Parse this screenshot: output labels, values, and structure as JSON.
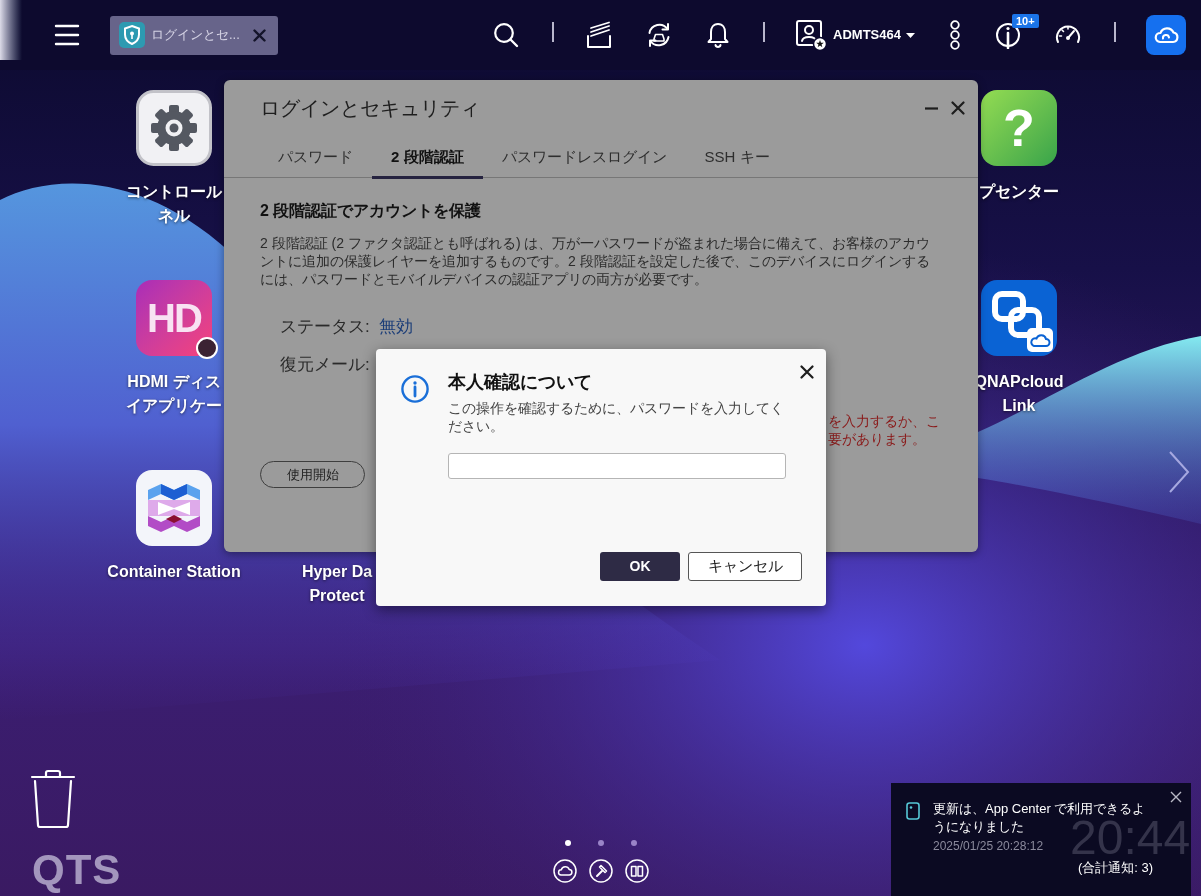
{
  "top_bar": {
    "open_windows": [
      {
        "title": "ログインとセ...",
        "selected": true
      }
    ],
    "user": "ADMTS464",
    "info_badge": "10+"
  },
  "desktop": {
    "left_column": [
      {
        "kind": "gear",
        "label_lines": [
          "コントロール",
          "ネル"
        ]
      },
      {
        "kind": "hd",
        "logo_text": "HD",
        "label_lines": [
          "HDMI ディス",
          "イアプリケー"
        ]
      },
      {
        "kind": "container",
        "label_lines": [
          "Container Station"
        ]
      }
    ],
    "second_column": [
      {
        "label_lines": [
          "Hyper Da",
          "Protect"
        ]
      }
    ],
    "right_column": [
      {
        "kind": "help",
        "logo_text": "?",
        "label_lines": [
          "プセンター"
        ]
      },
      {
        "kind": "cloud_link",
        "label_lines": [
          "QNAPcloud",
          "Link"
        ]
      }
    ]
  },
  "login_window": {
    "title": "ログインとセキュリティ",
    "tabs": [
      {
        "label": "パスワード",
        "selected": false
      },
      {
        "label": "2 段階認証",
        "selected": true
      },
      {
        "label": "パスワードレスログイン",
        "selected": false
      },
      {
        "label": "SSH キー",
        "selected": false
      }
    ],
    "heading": "2 段階認証でアカウントを保護",
    "description": "2 段階認証 (2 ファクタ認証とも呼ばれる) は、万が一パスワードが盗まれた場合に備えて、お客様のアカウントに追加の保護レイヤーを追加するものです。2 段階認証を設定した後で、このデバイスにログインするには、パスワードとモバイルデバイスの認証アプリの両方が必要です。",
    "status": {
      "label": "ステータス:",
      "value": "無効"
    },
    "recovery_email": {
      "label": "復元メール:"
    },
    "warning_lines": [
      "を入力するか、こ",
      "要があります。"
    ],
    "start_button": "使用開始"
  },
  "confirm_dialog": {
    "title": "本人確認について",
    "message": "この操作を確認するために、パスワードを入力してください。",
    "buttons": [
      {
        "label": "OK",
        "kind": "primary"
      },
      {
        "label": "キャンセル",
        "kind": "secondary"
      }
    ]
  },
  "footer": {
    "logo": "QTS",
    "page_dots": [
      {
        "selected": true
      },
      {
        "selected": false
      },
      {
        "selected": false
      }
    ]
  },
  "notification": {
    "message": "更新は、App Center で利用できるようになりました",
    "time": "2025/01/25 20:28:12",
    "total": "(合計通知: 3)"
  },
  "clock": {
    "time": "20:44"
  }
}
